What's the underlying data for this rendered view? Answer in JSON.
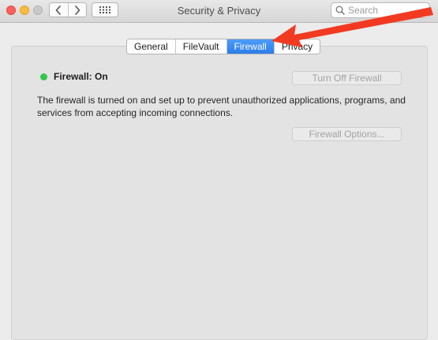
{
  "window": {
    "title": "Security & Privacy"
  },
  "toolbar": {
    "back_icon": "chevron-left-icon",
    "forward_icon": "chevron-right-icon",
    "show_all_icon": "grid-icon"
  },
  "search": {
    "placeholder": "Search",
    "value": ""
  },
  "tabs": [
    {
      "label": "General",
      "active": false
    },
    {
      "label": "FileVault",
      "active": false
    },
    {
      "label": "Firewall",
      "active": true
    },
    {
      "label": "Privacy",
      "active": false
    }
  ],
  "firewall": {
    "status_label": "Firewall: On",
    "status_color": "#34c84a",
    "turn_off_label": "Turn Off Firewall",
    "description": "The firewall is turned on and set up to prevent unauthorized applications, programs, and services from accepting incoming connections.",
    "options_label": "Firewall Options..."
  },
  "colors": {
    "accent": "#2b7de9",
    "annotation_arrow": "#f23a22"
  }
}
